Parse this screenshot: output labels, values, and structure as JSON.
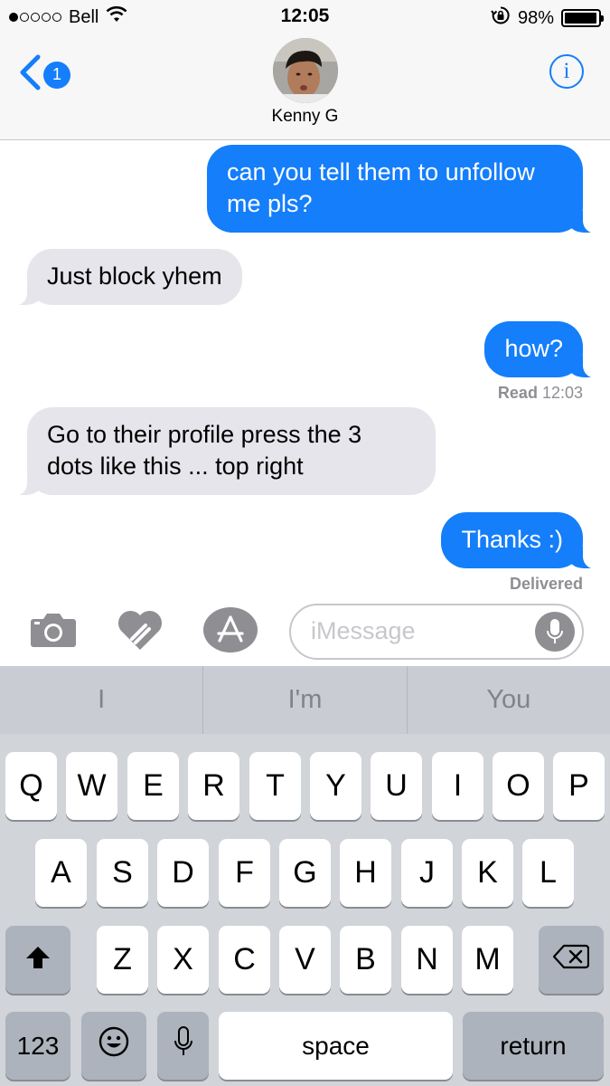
{
  "status_bar": {
    "carrier": "Bell",
    "time": "12:05",
    "battery_percent": "98%",
    "battery_level": 0.98,
    "signal_dots_filled": 1,
    "signal_dots_total": 5
  },
  "nav": {
    "back_badge_count": "1",
    "contact_name": "Kenny G",
    "info_label": "i"
  },
  "messages": [
    {
      "direction": "outgoing",
      "lines": [
        "can you tell them to unfollow",
        "me pls?"
      ]
    },
    {
      "direction": "incoming",
      "lines": [
        "Just block yhem"
      ]
    },
    {
      "direction": "outgoing",
      "lines": [
        "how?"
      ]
    },
    {
      "direction": "incoming",
      "lines": [
        "Go to their profile press the 3",
        "dots like this ... top right"
      ]
    },
    {
      "direction": "outgoing",
      "lines": [
        "Thanks :)"
      ]
    }
  ],
  "receipts": {
    "read_label": "Read",
    "read_time": "12:03",
    "delivered": "Delivered"
  },
  "input": {
    "placeholder": "iMessage"
  },
  "keyboard": {
    "predictions": [
      "I",
      "I'm",
      "You"
    ],
    "row1": [
      "Q",
      "W",
      "E",
      "R",
      "T",
      "Y",
      "U",
      "I",
      "O",
      "P"
    ],
    "row2": [
      "A",
      "S",
      "D",
      "F",
      "G",
      "H",
      "J",
      "K",
      "L"
    ],
    "row3": [
      "Z",
      "X",
      "C",
      "V",
      "B",
      "N",
      "M"
    ],
    "numbers_label": "123",
    "space_label": "space",
    "return_label": "return"
  },
  "colors": {
    "accent_blue": "#147efb",
    "incoming_bubble": "#e6e5eb",
    "keyboard_bg": "#d1d4d9",
    "function_key": "#adb3bc"
  }
}
